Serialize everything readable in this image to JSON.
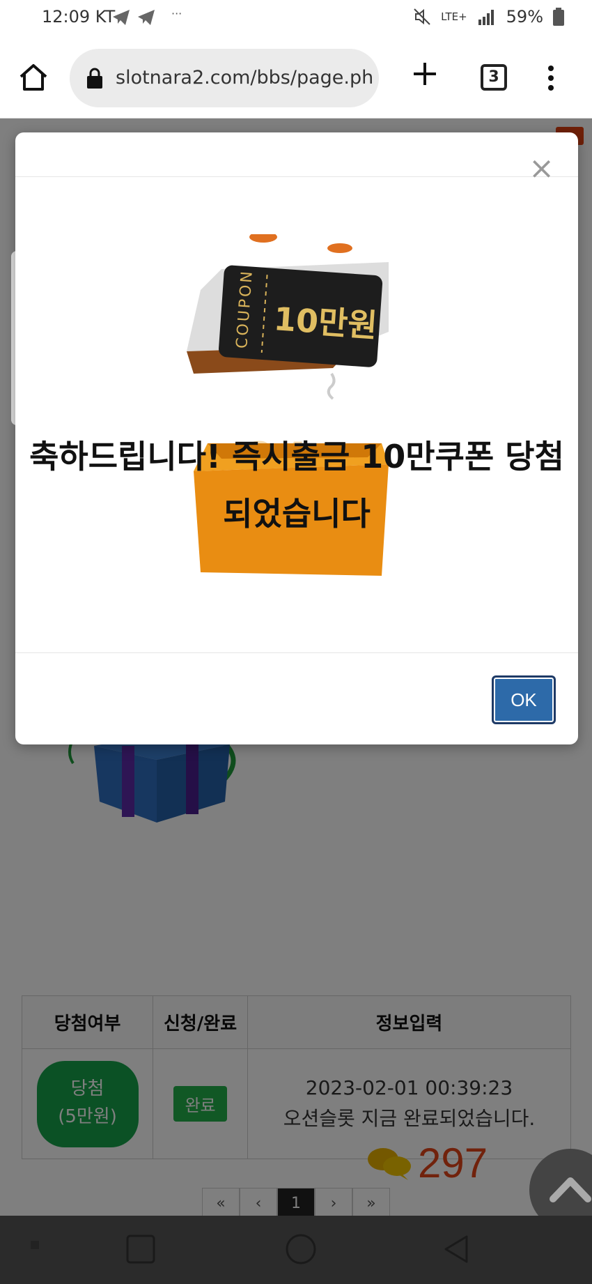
{
  "status_bar": {
    "time": "12:09 KT",
    "overflow_dots": "···",
    "network": "LTE+",
    "battery": "59%"
  },
  "browser": {
    "url": "slotnara2.com/bbs/page.php",
    "tab_count": "3"
  },
  "modal": {
    "close_label": "×",
    "coupon_word": "COUPON",
    "coupon_amount": "10만원",
    "message_line1": "축하드립니다! 즉시출금 10만쿠폰 당첨",
    "message_line2": "되었습니다",
    "ok_label": "OK"
  },
  "table": {
    "headers": [
      "당첨여부",
      "신청/완료",
      "정보입력"
    ],
    "row": {
      "result_line1": "당첨",
      "result_line2": "(5만원)",
      "status": "완료",
      "date": "2023-02-01 00:39:23",
      "message": "오션슬롯 지금 완료되었습니다."
    }
  },
  "comments": {
    "count": "297"
  },
  "pagination": [
    "«",
    "‹",
    "1",
    "›",
    "»"
  ],
  "colors": {
    "win_green": "#16a34a",
    "done_green": "#22b04b",
    "ok_blue": "#2d6aa9",
    "comment_red": "#e24418"
  }
}
